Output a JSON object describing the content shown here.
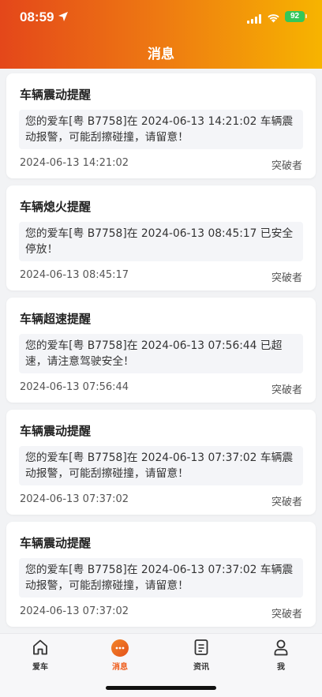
{
  "status_bar": {
    "time": "08:59",
    "battery": "92"
  },
  "header": {
    "title": "消息"
  },
  "messages": [
    {
      "title": "车辆震动提醒",
      "content": "您的爱车[粤 B7758]在 2024-06-13 14:21:02 车辆震动报警，可能刮擦碰撞，请留意！",
      "time": "2024-06-13 14:21:02",
      "sender": "突破者"
    },
    {
      "title": "车辆熄火提醒",
      "content": "您的爱车[粤 B7758]在 2024-06-13 08:45:17 已安全停放！",
      "time": "2024-06-13 08:45:17",
      "sender": "突破者"
    },
    {
      "title": "车辆超速提醒",
      "content": "您的爱车[粤 B7758]在 2024-06-13 07:56:44 已超速，请注意驾驶安全！",
      "time": "2024-06-13 07:56:44",
      "sender": "突破者"
    },
    {
      "title": "车辆震动提醒",
      "content": "您的爱车[粤 B7758]在 2024-06-13 07:37:02 车辆震动报警，可能刮擦碰撞，请留意！",
      "time": "2024-06-13 07:37:02",
      "sender": "突破者"
    },
    {
      "title": "车辆震动提醒",
      "content": "您的爱车[粤 B7758]在 2024-06-13 07:37:02 车辆震动报警，可能刮擦碰撞，请留意！",
      "time": "2024-06-13 07:37:02",
      "sender": "突破者"
    }
  ],
  "tabbar": {
    "items": [
      {
        "label": "爱车",
        "icon": "home-icon"
      },
      {
        "label": "消息",
        "icon": "message-icon",
        "active": true
      },
      {
        "label": "资讯",
        "icon": "news-icon"
      },
      {
        "label": "我",
        "icon": "profile-icon"
      }
    ]
  },
  "colors": {
    "accent": "#ee5a18",
    "header_start": "#e4471a",
    "header_end": "#f7b400"
  }
}
